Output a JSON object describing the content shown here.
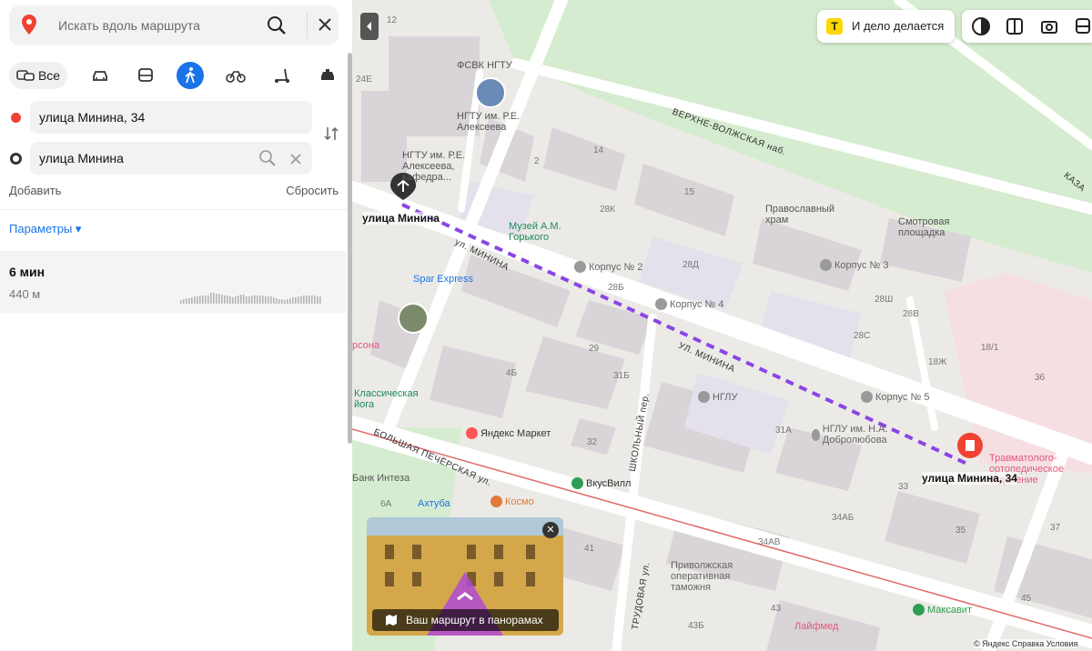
{
  "search": {
    "placeholder": "Искать вдоль маршрута",
    "icon": "search-icon"
  },
  "modes": {
    "all_label": "Все",
    "items": [
      "car-icon",
      "bus-icon",
      "walk-icon",
      "bike-icon",
      "scooter-icon",
      "taxi-icon"
    ],
    "active": "walk-icon"
  },
  "route_points": [
    {
      "value": "улица Минина, 34",
      "color": "#f04132"
    },
    {
      "value": "улица Минина",
      "color": "#333333"
    }
  ],
  "actions": {
    "add": "Добавить",
    "reset": "Сбросить"
  },
  "params": {
    "label": "Параметры ▾"
  },
  "route": {
    "time": "6 мин",
    "distance": "440 м"
  },
  "promo": {
    "badge": "T",
    "text": "И дело делается"
  },
  "panorama": {
    "label": "Ваш маршрут в панорамах",
    "close": "✕"
  },
  "copyright": "© Яндекс  Справка  Условия",
  "colors": {
    "accent": "#1a73e8",
    "route": "#8a45e6",
    "start": "#f04132"
  },
  "map": {
    "streets": [
      "ВЕРХНЕ-ВОЛЖСКАЯ наб.",
      "ул. МИНИНА",
      "УЛ. МИНИНА",
      "БОЛЬШАЯ ПЕЧЁРСКАЯ ул.",
      "ШКОЛЬНЫЙ пер.",
      "ТРУДОВАЯ ул.",
      "КАЗА"
    ],
    "labels": [
      {
        "t": "12"
      },
      {
        "t": "ФСВК НГТУ"
      },
      {
        "t": "24Е"
      },
      {
        "t": "НГТУ им. Р.Е. Алексеева"
      },
      {
        "t": "НГТУ им. Р.Е. Алексеева, кафедра..."
      },
      {
        "t": "14"
      },
      {
        "t": "2"
      },
      {
        "t": "15"
      },
      {
        "t": "28К"
      },
      {
        "t": "Музей А.М. Горького"
      },
      {
        "t": "Православный храм"
      },
      {
        "t": "Смотровая площадка"
      },
      {
        "t": "Корпус № 2"
      },
      {
        "t": "28Д"
      },
      {
        "t": "Корпус № 3"
      },
      {
        "t": "28Б"
      },
      {
        "t": "Корпус № 4"
      },
      {
        "t": "28Ш"
      },
      {
        "t": "28В"
      },
      {
        "t": "28С"
      },
      {
        "t": "Spar Express"
      },
      {
        "t": "18/1"
      },
      {
        "t": "36"
      },
      {
        "t": "18Ж"
      },
      {
        "t": "29"
      },
      {
        "t": "31Б"
      },
      {
        "t": "4Б"
      },
      {
        "t": "Корпус № 5"
      },
      {
        "t": "НГЛУ"
      },
      {
        "t": "31А"
      },
      {
        "t": "НГЛУ им. Н.А. Добролюбова"
      },
      {
        "t": "Яндекс Маркет"
      },
      {
        "t": "32"
      },
      {
        "t": "Классическая йога"
      },
      {
        "t": "рсона"
      },
      {
        "t": "Травматолого-ортопедическое отделение"
      },
      {
        "t": "33"
      },
      {
        "t": "ВкусВилл"
      },
      {
        "t": "Банк Интеза"
      },
      {
        "t": "Ахтуба"
      },
      {
        "t": "Космо"
      },
      {
        "t": "6А"
      },
      {
        "t": "34АБ"
      },
      {
        "t": "35"
      },
      {
        "t": "34АВ"
      },
      {
        "t": "41"
      },
      {
        "t": "Приволжская оперативная таможня"
      },
      {
        "t": "43"
      },
      {
        "t": "Максавит"
      },
      {
        "t": "43Б"
      },
      {
        "t": "Лайфмед"
      },
      {
        "t": "37"
      },
      {
        "t": "45"
      }
    ],
    "pins": {
      "start": "улица Минина",
      "end": "улица Минина, 34"
    }
  }
}
